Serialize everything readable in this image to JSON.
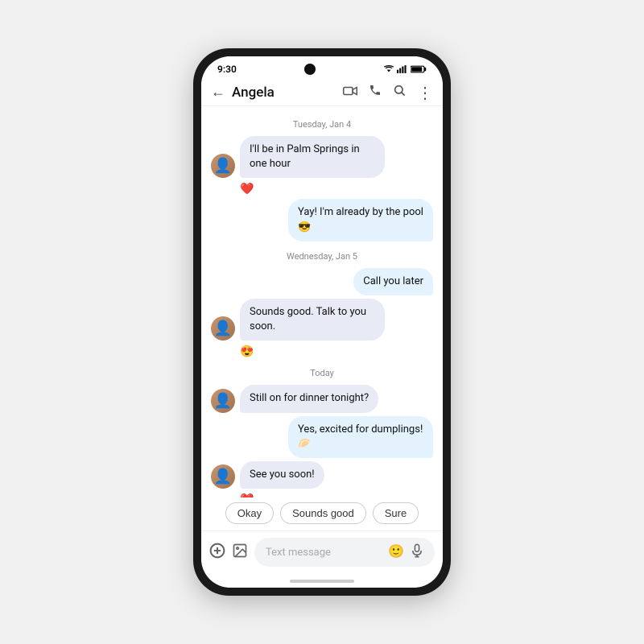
{
  "status": {
    "time": "9:30"
  },
  "header": {
    "contact_name": "Angela",
    "back_label": "←",
    "video_icon": "📹",
    "call_icon": "📞",
    "search_icon": "🔍",
    "more_icon": "⋮"
  },
  "messages": [
    {
      "id": "date1",
      "type": "date",
      "text": "Tuesday, Jan 4"
    },
    {
      "id": "msg1",
      "type": "received",
      "text": "I'll be in Palm Springs in one hour",
      "reaction": "❤️"
    },
    {
      "id": "msg2",
      "type": "sent",
      "text": "Yay! I'm already by the pool 😎"
    },
    {
      "id": "date2",
      "type": "date",
      "text": "Wednesday, Jan 5"
    },
    {
      "id": "msg3",
      "type": "sent",
      "text": "Call you later"
    },
    {
      "id": "msg4",
      "type": "received",
      "text": "Sounds good. Talk to you soon.",
      "reaction": "😍"
    },
    {
      "id": "date3",
      "type": "date",
      "text": "Today"
    },
    {
      "id": "msg5",
      "type": "received",
      "text": "Still on for dinner tonight?"
    },
    {
      "id": "msg6",
      "type": "sent",
      "text": "Yes, excited for dumplings! 🥟"
    },
    {
      "id": "msg7",
      "type": "received",
      "text": "See you soon!",
      "reaction": "❤️"
    }
  ],
  "smart_replies": [
    {
      "label": "Okay"
    },
    {
      "label": "Sounds good"
    },
    {
      "label": "Sure"
    }
  ],
  "input": {
    "placeholder": "Text message"
  }
}
